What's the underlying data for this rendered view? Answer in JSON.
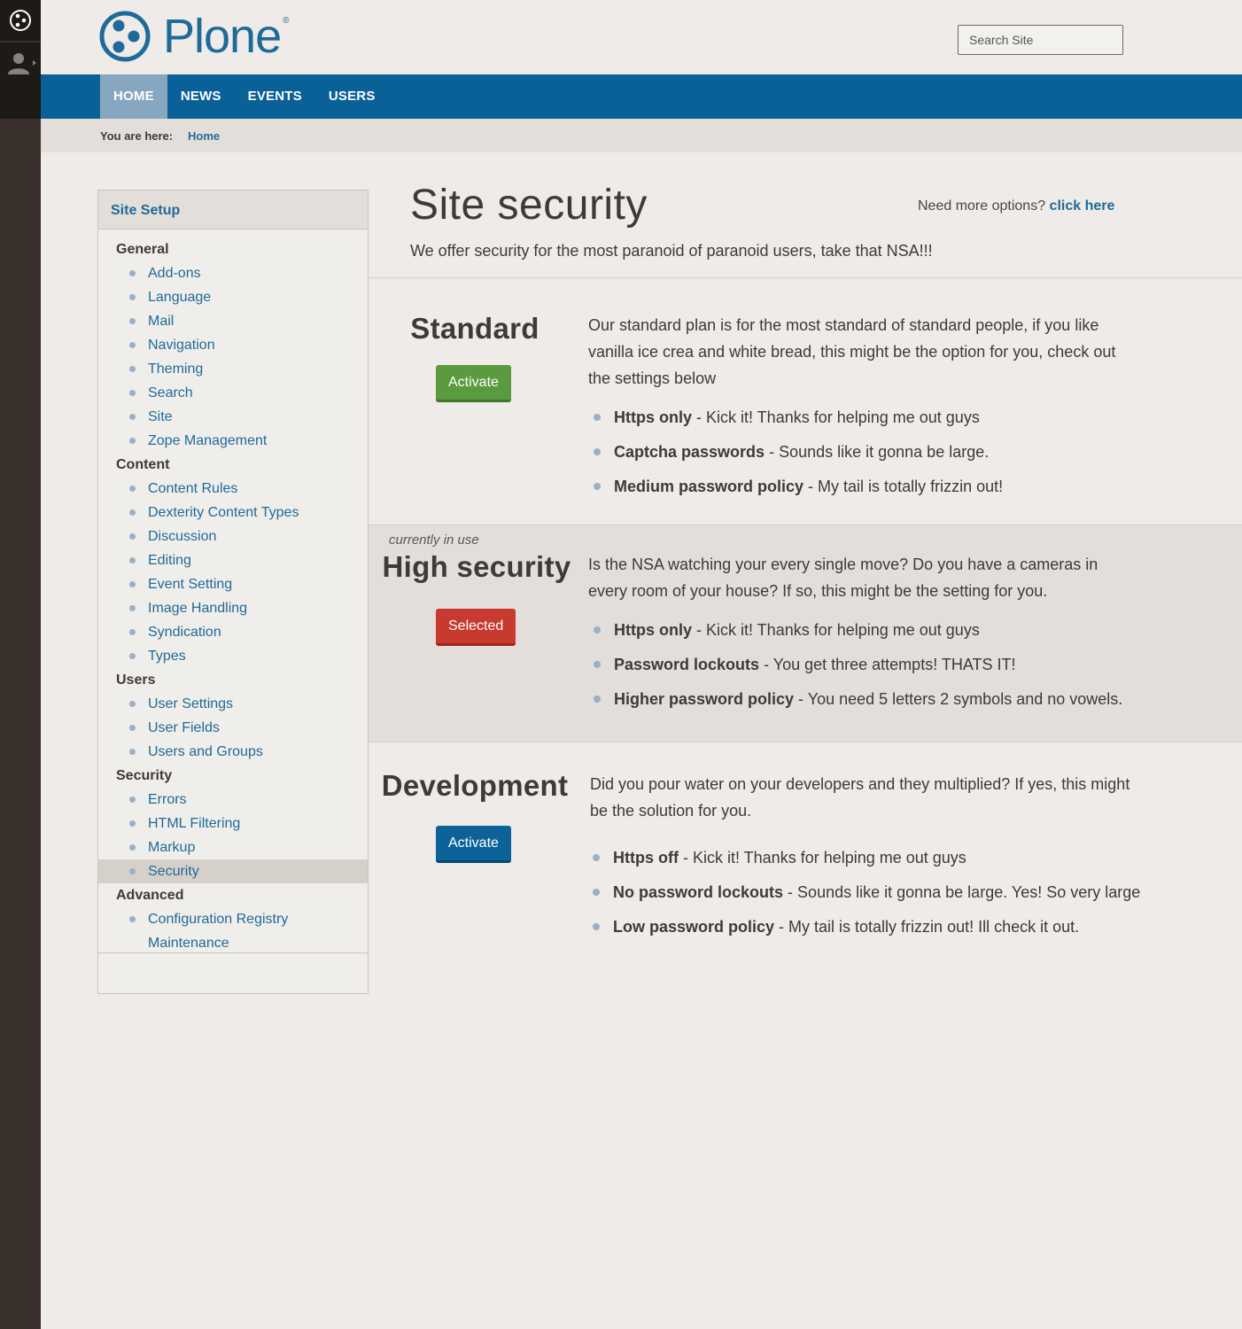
{
  "brand": {
    "name": "Plone",
    "reg": "®",
    "color": "#1f6a99"
  },
  "search": {
    "placeholder": "Search Site"
  },
  "nav": {
    "items": [
      {
        "label": "HOME",
        "active": true
      },
      {
        "label": "NEWS"
      },
      {
        "label": "EVENTS"
      },
      {
        "label": "USERS"
      }
    ]
  },
  "breadcrumb": {
    "label": "You are here:",
    "home": "Home"
  },
  "sidebar": {
    "title": "Site Setup",
    "groups": [
      {
        "category": "General",
        "items": [
          "Add-ons",
          "Language",
          "Mail",
          "Navigation",
          "Theming",
          "Search",
          "Site",
          "Zope Management"
        ]
      },
      {
        "category": "Content",
        "items": [
          "Content Rules",
          "Dexterity Content Types",
          "Discussion",
          "Editing",
          "Event Setting",
          "Image Handling",
          "Syndication",
          "Types"
        ]
      },
      {
        "category": "Users",
        "items": [
          "User Settings",
          "User Fields",
          "Users and Groups"
        ]
      },
      {
        "category": "Security",
        "items": [
          "Errors",
          "HTML Filtering",
          "Markup",
          "Security"
        ]
      },
      {
        "category": "Advanced",
        "items": [
          "Configuration Registry",
          "Maintenance"
        ]
      }
    ],
    "active_item": "Security"
  },
  "page": {
    "title": "Site security",
    "more_options_text": "Need more options?",
    "more_options_link": "click here",
    "description": "We offer security for the most paranoid of paranoid users, take that NSA!!!"
  },
  "plans": [
    {
      "title": "Standard",
      "button": "Activate",
      "description": "Our standard plan is for the most standard of standard people, if you like vanilla ice crea and white bread, this might be the option for you, check out the settings below",
      "features": [
        {
          "name": "Https only",
          "text": "Kick it! Thanks for helping me out guys"
        },
        {
          "name": "Captcha passwords",
          "text": "Sounds like it gonna be large."
        },
        {
          "name": "Medium password policy",
          "text": "My tail is totally frizzin out!"
        }
      ]
    },
    {
      "title": "High security",
      "usage": "currently in use",
      "button": "Selected",
      "description": "Is the NSA watching your every single move? Do you have a cameras in every room of your house? If so, this might be the setting for you.",
      "features": [
        {
          "name": "Https only",
          "text": "Kick it! Thanks for helping me out guys"
        },
        {
          "name": "Password lockouts",
          "text": "You get three attempts! THATS IT!"
        },
        {
          "name": "Higher password policy",
          "text": "You need 5 letters 2 symbols and no vowels."
        }
      ]
    },
    {
      "title": "Development",
      "button": "Activate",
      "description": "Did you pour water on your developers and they multiplied? If yes, this might be the solution for you.",
      "features": [
        {
          "name": "Https off",
          "text": "Kick it! Thanks for helping me out guys"
        },
        {
          "name": "No password lockouts",
          "text": "Sounds like it gonna be large. Yes! So very large"
        },
        {
          "name": "Low password policy",
          "text": "My tail is totally frizzin out! Ill check it out."
        }
      ]
    }
  ],
  "colors": {
    "accent": "#1f6a99",
    "navbar": "#0a6197",
    "nav_active": "#87a6c0",
    "button_green": "#5b9a3e",
    "button_red": "#c8392f",
    "button_blue": "#0d6399"
  },
  "icons": {
    "toolbar_logo": "plone-logo-icon",
    "toolbar_user": "user-icon",
    "brand_logo": "plone-logo-icon"
  }
}
